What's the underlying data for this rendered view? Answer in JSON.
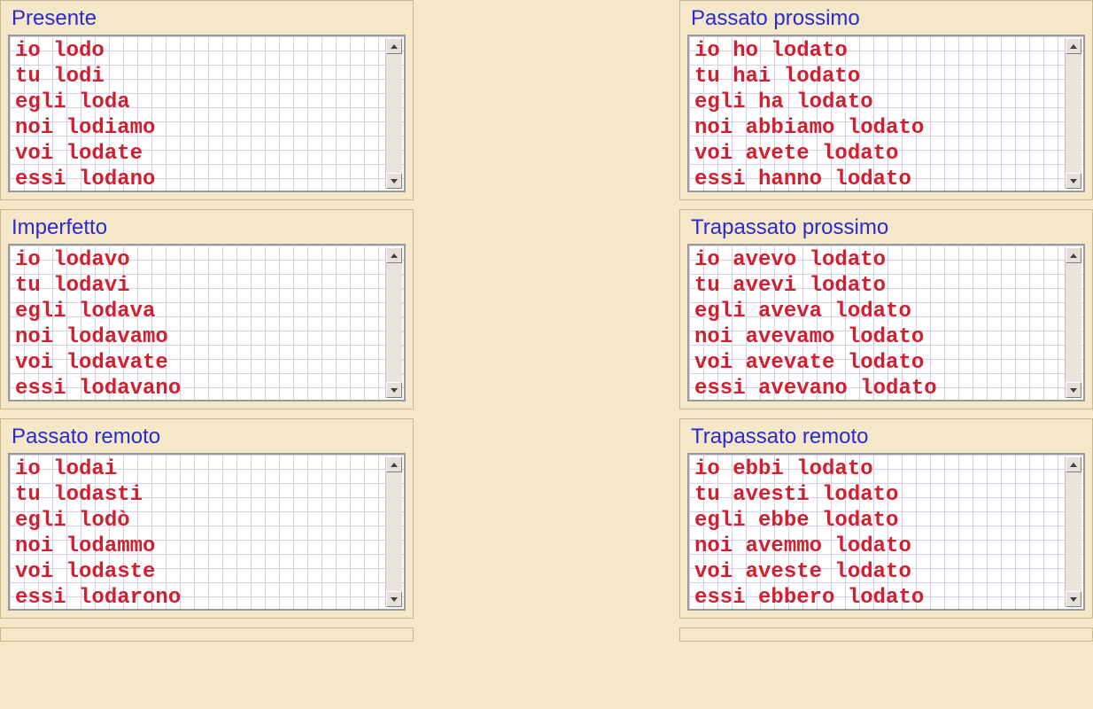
{
  "tenses": [
    {
      "title": "Presente",
      "name": "presente",
      "lines": [
        "io lodo",
        "tu lodi",
        "egli loda",
        "noi lodiamo",
        "voi lodate",
        "essi lodano"
      ]
    },
    {
      "title": "Passato prossimo",
      "name": "passato-prossimo",
      "lines": [
        "io ho lodato",
        "tu hai lodato",
        "egli ha lodato",
        "noi abbiamo lodato",
        "voi avete lodato",
        "essi hanno lodato"
      ]
    },
    {
      "title": "Imperfetto",
      "name": "imperfetto",
      "lines": [
        "io lodavo",
        "tu lodavi",
        "egli lodava",
        "noi lodavamo",
        "voi lodavate",
        "essi lodavano"
      ]
    },
    {
      "title": "Trapassato prossimo",
      "name": "trapassato-prossimo",
      "lines": [
        "io avevo lodato",
        "tu avevi lodato",
        "egli aveva lodato",
        "noi avevamo lodato",
        "voi avevate lodato",
        "essi avevano lodato"
      ]
    },
    {
      "title": "Passato remoto",
      "name": "passato-remoto",
      "lines": [
        "io lodai",
        "tu lodasti",
        "egli lodò",
        "noi lodammo",
        "voi lodaste",
        "essi lodarono"
      ]
    },
    {
      "title": "Trapassato remoto",
      "name": "trapassato-remoto",
      "lines": [
        "io ebbi lodato",
        "tu avesti lodato",
        "egli ebbe lodato",
        "noi avemmo lodato",
        "voi aveste lodato",
        "essi ebbero lodato"
      ]
    }
  ]
}
